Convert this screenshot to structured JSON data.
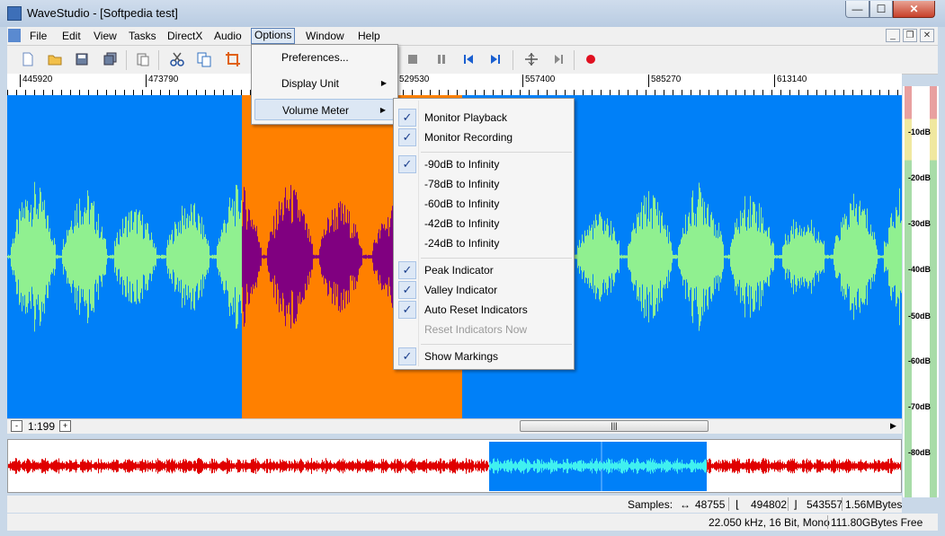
{
  "window": {
    "title": "WaveStudio - [Softpedia test]"
  },
  "window_buttons": {
    "minimize": "—",
    "maximize": "☐",
    "close": "✕"
  },
  "menu": {
    "items": [
      "File",
      "Edit",
      "View",
      "Tasks",
      "DirectX",
      "Audio",
      "Options",
      "Window",
      "Help"
    ]
  },
  "mdi_buttons": {
    "minimize": "_",
    "restore": "❐",
    "close": "✕"
  },
  "toolbar": {
    "icons": [
      "new-file-icon",
      "open-folder-icon",
      "save-icon",
      "save-all-icon",
      "paste-special-icon",
      "cut-icon",
      "copy-icon",
      "crop-icon",
      "stop-icon",
      "pause-icon",
      "skip-back-icon",
      "skip-forward-icon",
      "split-icon",
      "step-icon",
      "record-icon"
    ]
  },
  "ruler": {
    "labels": [
      "445920",
      "473790",
      "529530",
      "557400",
      "585270",
      "613140"
    ]
  },
  "zoom": {
    "value": "1:199",
    "zoom_out": "-",
    "zoom_in": "+"
  },
  "scrollbar": {
    "thumb_grip": "|||",
    "right_arrow": "▶"
  },
  "options_menu": {
    "items": [
      {
        "label": "Preferences..."
      },
      {
        "label": "Display Unit",
        "arrow": "▶"
      },
      {
        "label": "Volume Meter",
        "arrow": "▶"
      }
    ]
  },
  "volume_meter_menu": {
    "items": [
      {
        "label": "Monitor Playback",
        "checked": true
      },
      {
        "label": "Monitor Recording",
        "checked": true
      },
      {
        "label": "-90dB to Infinity",
        "checked": true
      },
      {
        "label": "-78dB to Infinity",
        "checked": false
      },
      {
        "label": "-60dB to Infinity",
        "checked": false
      },
      {
        "label": "-42dB to Infinity",
        "checked": false
      },
      {
        "label": "-24dB to Infinity",
        "checked": false
      },
      {
        "label": "Peak Indicator",
        "checked": true
      },
      {
        "label": "Valley Indicator",
        "checked": true
      },
      {
        "label": "Auto Reset Indicators",
        "checked": true
      },
      {
        "label": "Reset Indicators Now",
        "checked": false,
        "disabled": true
      },
      {
        "label": "Show Markings",
        "checked": true
      }
    ],
    "check_glyph": "✓"
  },
  "volume_meter": {
    "labels": [
      "-10dB",
      "-20dB",
      "-30dB",
      "-40dB",
      "-50dB",
      "-60dB",
      "-70dB",
      "-80dB"
    ]
  },
  "status": {
    "samples_label": "Samples:",
    "length": "48755",
    "start": "494802",
    "end": "543557",
    "size": "1.56MBytes",
    "format": "22.050 kHz, 16 Bit, Mono",
    "free_space": "111.80GBytes Free"
  },
  "colors": {
    "wave_bg": "#0080f8",
    "selection_bg": "#ff8000",
    "wave_green": "#90f090",
    "wave_selected": "#800080",
    "overview_wave": "#e00000",
    "overview_selection": "#0080f8",
    "overview_selected_wave": "#40f0f0"
  }
}
